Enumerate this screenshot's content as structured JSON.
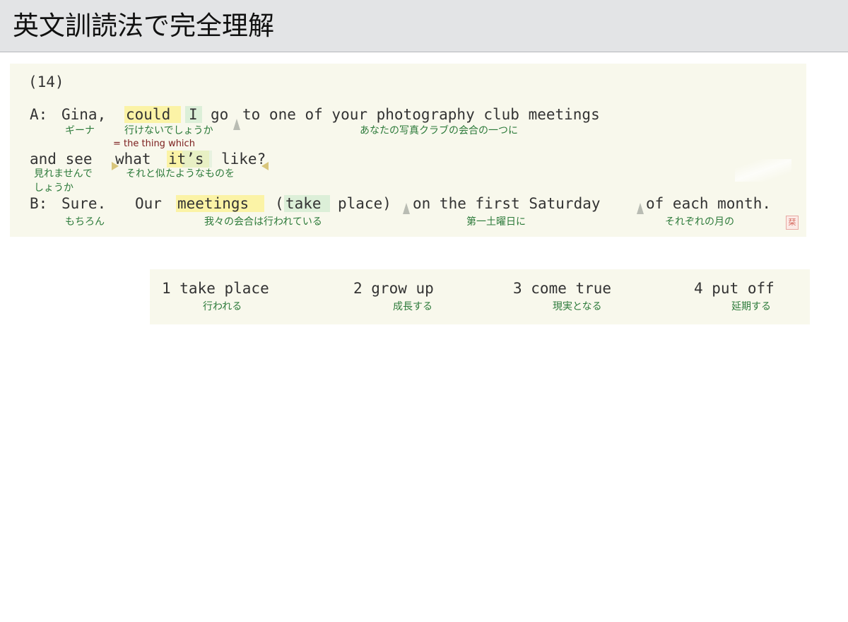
{
  "header": {
    "title": "英文訓読法で完全理解"
  },
  "exercise": {
    "number": "(14)",
    "line1": {
      "speaker": "A:",
      "w1": "Gina,",
      "w2": "could",
      "w3": "I",
      "w4": "go",
      "w5": "to one of your photography club meetings"
    },
    "line1_glosses": {
      "g1": "ギーナ",
      "g2": "行けないでしょうか",
      "g3": "あなたの写真クラブの会合の一つに"
    },
    "note": "= the thing which",
    "line2": {
      "w1": "and see",
      "w2": "what",
      "w3": "it’s",
      "w4": "like?"
    },
    "line2_glosses": {
      "g1a": "見れませんで",
      "g1b": "しょうか",
      "g2": "それと似たようなものを"
    },
    "line3": {
      "speaker": "B:",
      "w1": "Sure.",
      "w2": "Our",
      "w3": "meetings",
      "w4": "(",
      "w5": "take",
      "w6": "place)",
      "w7": "on the first Saturday",
      "w8": "of each month."
    },
    "line3_glosses": {
      "g1": "もちろん",
      "g2": "我々の会合は行われている",
      "g3": "第一土曜日に",
      "g4": "それぞれの月の"
    },
    "seal_char": "栞"
  },
  "choices": [
    {
      "term": "1 take place",
      "meaning": "行われる"
    },
    {
      "term": "2 grow up",
      "meaning": "成長する"
    },
    {
      "term": "3 come true",
      "meaning": "現実となる"
    },
    {
      "term": "4 put off",
      "meaning": "延期する"
    }
  ],
  "colors": {
    "panel_bg": "#f8f8ec",
    "header_bg": "#e3e4e6",
    "gloss_text": "#2c7a3a",
    "note_text": "#7a1c1c",
    "highlight_yellow": "#fbf3a6",
    "highlight_green": "#dcefd8"
  }
}
